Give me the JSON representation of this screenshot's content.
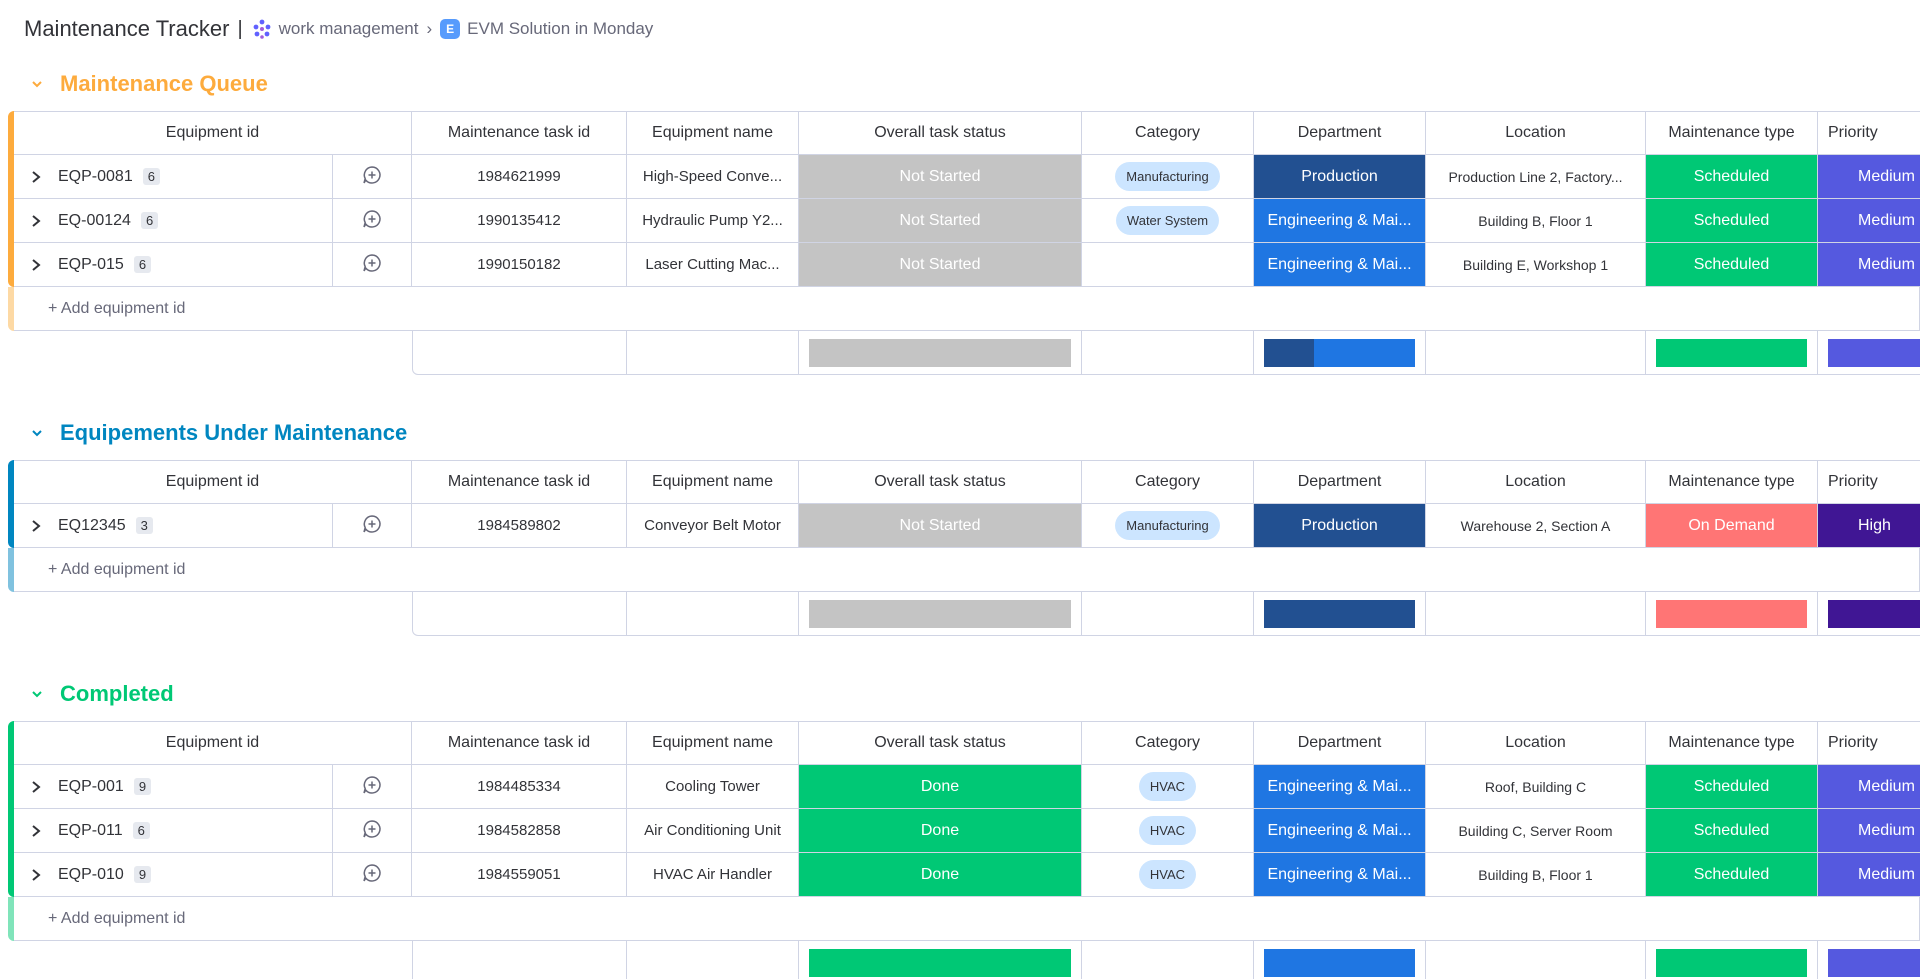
{
  "breadcrumb": {
    "title": "Maintenance Tracker",
    "separator": "|",
    "workspace": "work management",
    "chevron": "›",
    "board_letter": "E",
    "board": "EVM Solution in Monday"
  },
  "columns": {
    "equipment_id": "Equipment id",
    "task_id": "Maintenance task id",
    "name": "Equipment name",
    "status": "Overall task status",
    "category": "Category",
    "department": "Department",
    "location": "Location",
    "maintenance_type": "Maintenance type",
    "priority": "Priority"
  },
  "colors": {
    "not_started": "#c4c4c4",
    "done": "#00c875",
    "production": "#225091",
    "engineering": "#1f76e2",
    "scheduled": "#00c875",
    "on_demand": "#ff7575",
    "medium": "#5559df",
    "high": "#401694",
    "queue": "#fdab3d",
    "under_maintenance": "#0086c0",
    "completed": "#00c875"
  },
  "add_label": "+ Add equipment id",
  "groups": [
    {
      "title": "Maintenance Queue",
      "rows": [
        {
          "eq": "EQP-0081",
          "count": "6",
          "tid": "1984621999",
          "name": "High-Speed Conve...",
          "status": "Not Started",
          "category": "Manufacturing",
          "dept": "Production",
          "loc": "Production Line 2, Factory...",
          "mt": "Scheduled",
          "pri": "Medium"
        },
        {
          "eq": "EQ-00124",
          "count": "6",
          "tid": "1990135412",
          "name": "Hydraulic Pump Y2...",
          "status": "Not Started",
          "category": "Water System",
          "dept": "Engineering & Mai...",
          "loc": "Building B, Floor 1",
          "mt": "Scheduled",
          "pri": "Medium"
        },
        {
          "eq": "EQP-015",
          "count": "6",
          "tid": "1990150182",
          "name": "Laser Cutting Mac...",
          "status": "Not Started",
          "category": "",
          "dept": "Engineering & Mai...",
          "loc": "Building E, Workshop 1",
          "mt": "Scheduled",
          "pri": "Medium"
        }
      ]
    },
    {
      "title": "Equipements Under Maintenance",
      "rows": [
        {
          "eq": "EQ12345",
          "count": "3",
          "tid": "1984589802",
          "name": "Conveyor Belt Motor",
          "status": "Not Started",
          "category": "Manufacturing",
          "dept": "Production",
          "loc": "Warehouse 2, Section A",
          "mt": "On Demand",
          "pri": "High"
        }
      ]
    },
    {
      "title": "Completed",
      "rows": [
        {
          "eq": "EQP-001",
          "count": "9",
          "tid": "1984485334",
          "name": "Cooling Tower",
          "status": "Done",
          "category": "HVAC",
          "dept": "Engineering & Mai...",
          "loc": "Roof, Building C",
          "mt": "Scheduled",
          "pri": "Medium"
        },
        {
          "eq": "EQP-011",
          "count": "6",
          "tid": "1984582858",
          "name": "Air Conditioning Unit",
          "status": "Done",
          "category": "HVAC",
          "dept": "Engineering & Mai...",
          "loc": "Building C, Server Room",
          "mt": "Scheduled",
          "pri": "Medium"
        },
        {
          "eq": "EQP-010",
          "count": "9",
          "tid": "1984559051",
          "name": "HVAC Air Handler",
          "status": "Done",
          "category": "HVAC",
          "dept": "Engineering & Mai...",
          "loc": "Building B, Floor 1",
          "mt": "Scheduled",
          "pri": "Medium"
        }
      ]
    }
  ]
}
